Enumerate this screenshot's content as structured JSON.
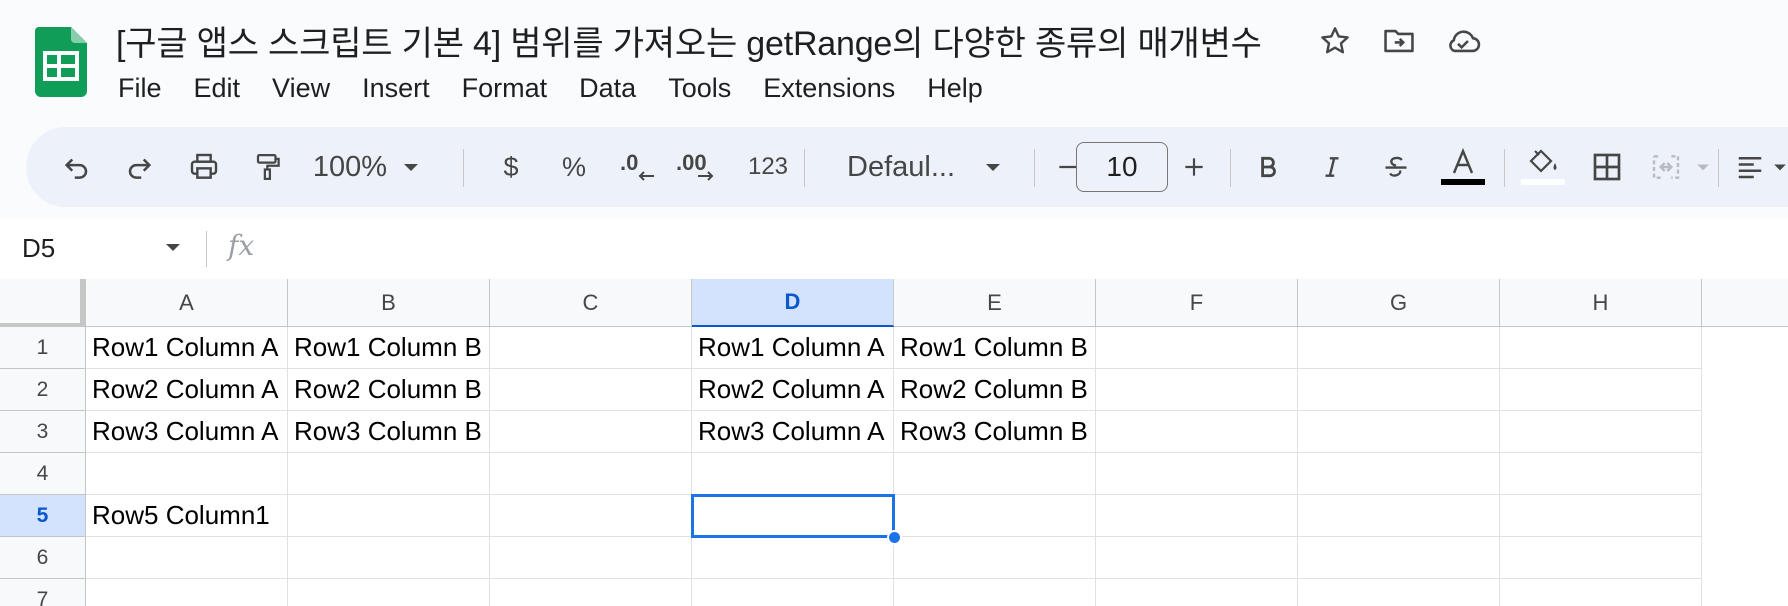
{
  "doc": {
    "title": "[구글 앱스 스크립트 기본 4] 범위를 가져오는 getRange의 다양한 종류의 매개변수"
  },
  "menu": [
    "File",
    "Edit",
    "View",
    "Insert",
    "Format",
    "Data",
    "Tools",
    "Extensions",
    "Help"
  ],
  "toolbar": {
    "zoom": "100%",
    "currency": "$",
    "percent": "%",
    "decrease_decimal": ".0",
    "increase_decimal": ".00",
    "number_format": "123",
    "font": "Defaul...",
    "font_size": "10",
    "minus": "−",
    "plus": "+"
  },
  "formula_bar": {
    "name_box": "D5",
    "fx_label": "fx"
  },
  "sheet": {
    "columns": [
      "A",
      "B",
      "C",
      "D",
      "E",
      "F",
      "G",
      "H"
    ],
    "rows": [
      "1",
      "2",
      "3",
      "4",
      "5",
      "6",
      "7"
    ],
    "selected_column": "D",
    "selected_row": "5",
    "cells": {
      "A1": "Row1 Column A",
      "B1": "Row1 Column B",
      "D1": "Row1 Column A",
      "E1": "Row1 Column B",
      "A2": "Row2 Column A",
      "B2": "Row2 Column B",
      "D2": "Row2 Column A",
      "E2": "Row2 Column B",
      "A3": "Row3 Column A",
      "B3": "Row3 Column B",
      "D3": "Row3 Column A",
      "E3": "Row3 Column B",
      "A5": "Row5 Column1"
    }
  },
  "colors": {
    "selection": "#1a73e8",
    "header_selected": "#d3e3fd",
    "logo_green": "#0f9d58"
  }
}
